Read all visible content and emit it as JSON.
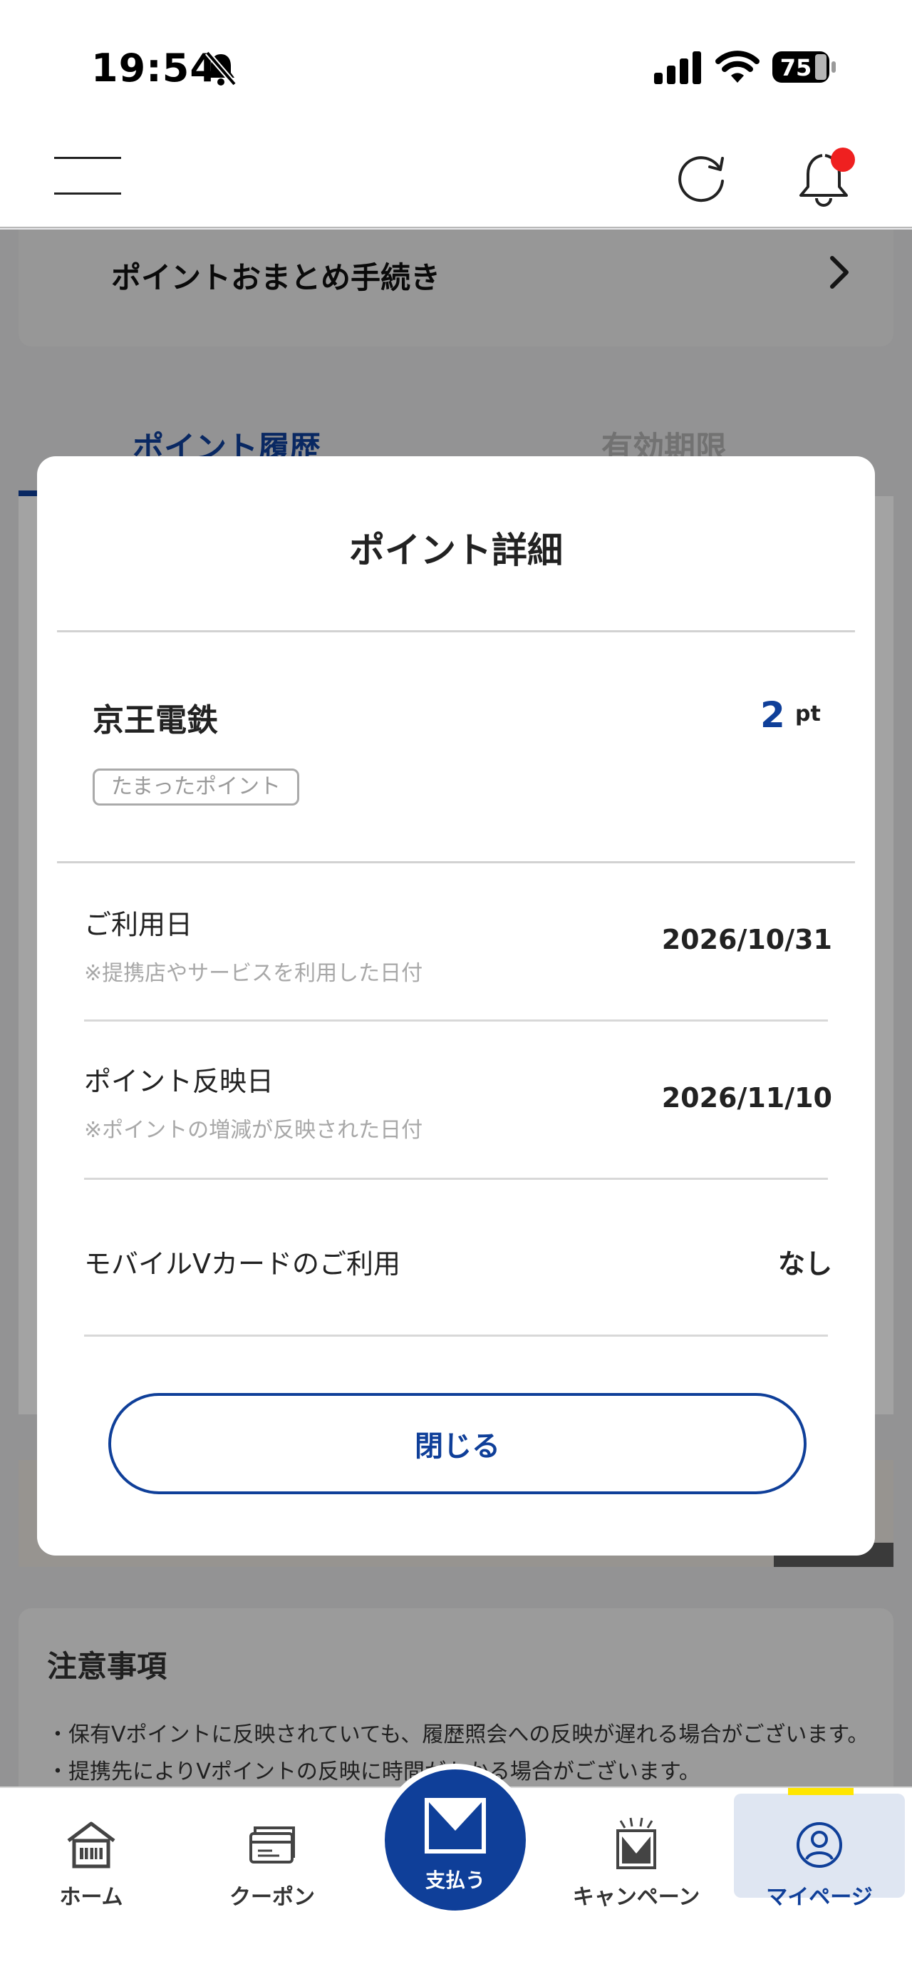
{
  "status_bar": {
    "time": "19:54",
    "battery": "75"
  },
  "background": {
    "top_card_label": "ポイントおまとめ手続き",
    "tabs": [
      {
        "label": "ポイント履歴"
      },
      {
        "label": "有効期限"
      }
    ],
    "notes_title": "注意事項",
    "notes": [
      "・保有Vポイントに反映されていても、履歴照会への反映が遅れる場合がございます。",
      "・提携先によりVポイントの反映に時間がかかる場合がございます。"
    ]
  },
  "modal": {
    "title": "ポイント詳細",
    "merchant": "京王電鉄",
    "points": "2",
    "points_unit": "pt",
    "badge": "たまったポイント",
    "rows": [
      {
        "label": "ご利用日",
        "note": "※提携店やサービスを利用した日付",
        "value": "2026/10/31"
      },
      {
        "label": "ポイント反映日",
        "note": "※ポイントの増減が反映された日付",
        "value": "2026/11/10"
      },
      {
        "label": "モバイルVカードのご利用",
        "note": "",
        "value": "なし"
      }
    ],
    "close_label": "閉じる"
  },
  "bottom_nav": {
    "items": [
      {
        "label": "ホーム",
        "icon": "home-icon"
      },
      {
        "label": "クーポン",
        "icon": "coupon-icon"
      },
      {
        "label": "支払う",
        "icon": "pay-icon"
      },
      {
        "label": "キャンペーン",
        "icon": "campaign-icon"
      },
      {
        "label": "マイページ",
        "icon": "mypage-icon"
      }
    ],
    "active": "マイページ"
  },
  "colors": {
    "brand": "#0f3f99",
    "active_indicator": "#ffe600",
    "notification_dot": "#ef2020"
  }
}
